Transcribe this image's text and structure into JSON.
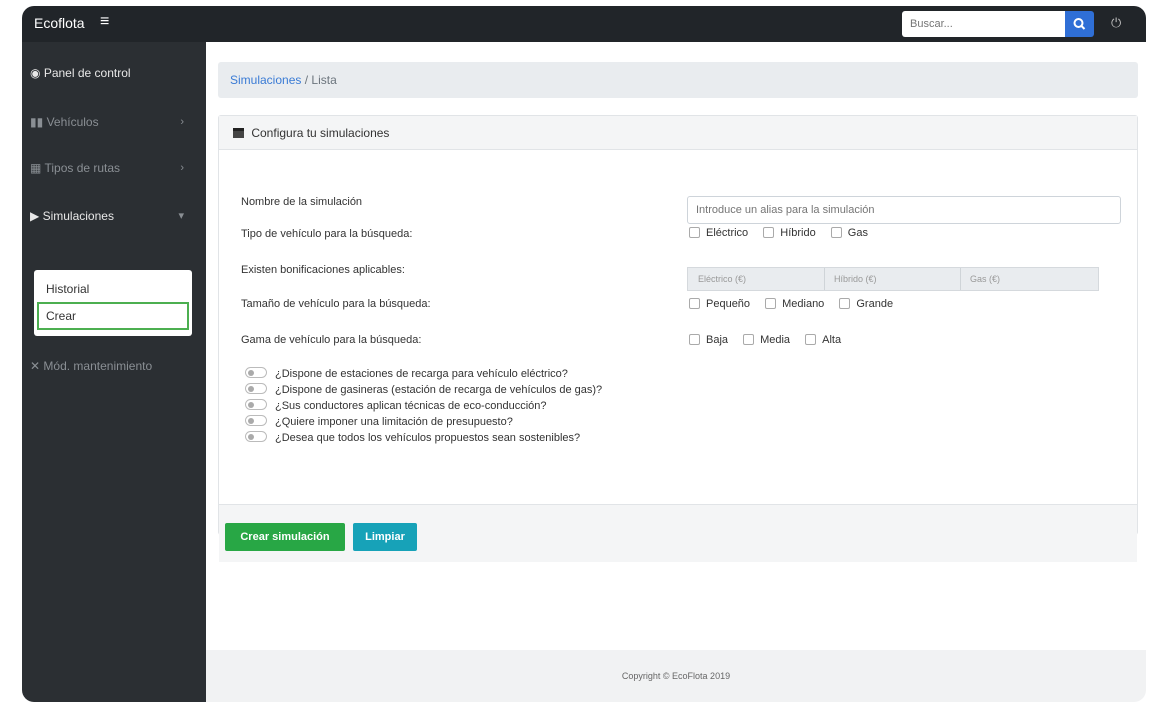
{
  "app": {
    "brand": "Ecoflota",
    "menu_glyph": "≡"
  },
  "search": {
    "placeholder": "Buscar...",
    "button_glyph": "🔍"
  },
  "user_glyph": "⏻",
  "sidebar": {
    "items": [
      {
        "icon": "dashboard-icon",
        "glyph": "◉",
        "label": "Panel de control"
      },
      {
        "icon": "vehicle-icon",
        "glyph": "▮▮",
        "label": "Vehículos",
        "caret": "›"
      },
      {
        "icon": "routes-icon",
        "glyph": "▦",
        "label": "Tipos de rutas",
        "caret": "›"
      },
      {
        "icon": "play-icon",
        "glyph": "▶",
        "label": "Simulaciones",
        "caret": "▾"
      },
      {
        "icon": "wrench-icon",
        "glyph": "✕",
        "label": "Mód. mantenimiento"
      }
    ],
    "submenu": [
      "Historial",
      "Crear"
    ]
  },
  "breadcrumb": {
    "link": "Simulaciones",
    "sep": "/",
    "current": "Lista"
  },
  "card": {
    "title": "Configura tu simulaciones",
    "labels": {
      "name": "Nombre de la simulación",
      "vehicle_type": "Tipo de vehículo para la búsqueda:",
      "bonus": "Existen bonificaciones aplicables:",
      "size": "Tamaño de vehículo para la búsqueda:",
      "range": "Gama de vehículo para la búsqueda:"
    },
    "alias_placeholder": "Introduce un alias para la simulación",
    "vehicle_types": [
      "Eléctrico",
      "Híbrido",
      "Gas"
    ],
    "bonus_fields": [
      "Eléctrico (€)",
      "Híbrido (€)",
      "Gas (€)"
    ],
    "sizes": [
      "Pequeño",
      "Mediano",
      "Grande"
    ],
    "ranges": [
      "Baja",
      "Media",
      "Alta"
    ],
    "questions": [
      "¿Dispone de estaciones de recarga para vehículo eléctrico?",
      "¿Dispone de gasineras (estación de recarga de vehículos de gas)?",
      "¿Sus conductores aplican técnicas de eco-conducción?",
      "¿Quiere imponer una limitación de presupuesto?",
      "¿Desea que todos los vehículos propuestos sean sostenibles?"
    ],
    "buttons": {
      "create": "Crear simulación",
      "clear": "Limpiar"
    }
  },
  "footer": "Copyright © EcoFlota 2019"
}
